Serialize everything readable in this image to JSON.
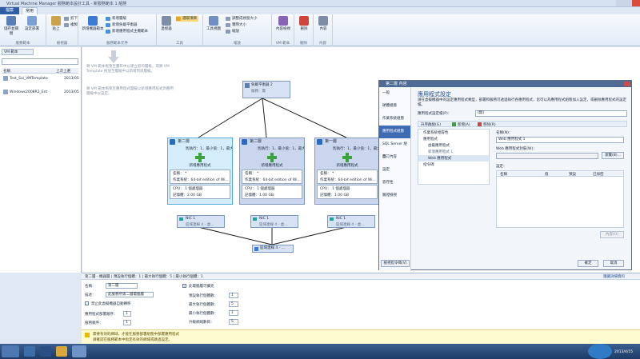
{
  "window": {
    "title": "Virtual Machine Manager 服務範本設計工具 - 新服務範本 1 組態"
  },
  "tabs": {
    "file": "檔案",
    "home": "常用"
  },
  "ribbon": {
    "save_run": "儲存並關閉",
    "set_config": "設定部署",
    "group_service_template": "服務範本",
    "cut": "剪下",
    "copy": "複製",
    "paste": "貼上",
    "group_edit": "檢視器",
    "new_vm_template": "新增機器範本",
    "new_tier": "新增層級",
    "new_app_tier": "新增服務層範本",
    "new_load_balancer": "新增負載平衡器",
    "new_logical_network": "新增應用程式主機範本",
    "group_components": "服務範本元件",
    "connect": "連接器",
    "select_item": "選取項目",
    "group_tools": "工具",
    "view_tools": "工具視圖",
    "zoom_normal": "調整成視窗大小",
    "zoom_actual": "實際大小",
    "zoom_level": "縮放",
    "group_view": "縮放",
    "vm_props": "內容檢視",
    "group_vm": "VM 範本",
    "delete": "刪除",
    "group_delete": "刪除",
    "properties": "內容",
    "group_props": "內容"
  },
  "leftpanel": {
    "tab": "VM 範本",
    "search_placeholder": "",
    "col_name": "名稱",
    "col_date": "上次上選",
    "items": [
      {
        "name": "Test_Sai_VMTemplate",
        "date": "2013/05"
      },
      {
        "name": "Windows2008R2_Ent",
        "date": "2013/05"
      }
    ]
  },
  "canvas": {
    "hint1": "將 VM 範本拖曳至畫布中以建立新的層級，或將 VM Template 拖放至層級中以新增到該層級。",
    "hint2": "將 VM 範本拖曳至應用程式層級以新增應用程式到應用層級中以設定。",
    "load_balancer": {
      "title": "負載平衡器 2",
      "sub": "服務：無"
    },
    "tiers": [
      {
        "title": "第二層",
        "counts": "別執行：1，最小值：1，最大值",
        "new_app": "新增應用程式",
        "name_label": "名稱：",
        "name_val": "*",
        "os": "作業系統：64-bit edition of Wi...",
        "cpu_label": "CPU：",
        "cpu_val": "1 個處理器",
        "mem": "記憶體：2.00 GB",
        "nic": "NIC 1",
        "nic_sub": "區域連線 4 - 虛..."
      },
      {
        "title": "第二層",
        "counts": "別執行：1，最小值：1，最大值",
        "new_app": "新增應用程式",
        "name_label": "名稱：",
        "name_val": "*",
        "os": "作業系統：64-bit edition of Wi...",
        "cpu_label": "CPU：",
        "cpu_val": "1 個處理器",
        "mem": "記憶體：1.00 GB",
        "nic": "NIC 1",
        "nic_sub": "區域連線 4 - 虛..."
      },
      {
        "title": "第一層",
        "counts": "別執行：1，最小值：1，最大值",
        "new_app": "新增應用程式",
        "name_label": "名稱：",
        "name_val": "*",
        "os": "作業系統：64-bit edition of Wi...",
        "cpu_label": "CPU：",
        "cpu_val": "1 個處理器",
        "mem": "記憶體：1.00 GB",
        "nic": "NIC 1",
        "nic_sub": "區域連線 4 - 虛..."
      }
    ],
    "network": "區域連線 4 - ..."
  },
  "dialog": {
    "title": "第二層 內容",
    "nav": [
      "一般",
      "硬體組態",
      "作業系統組態",
      "應用程式組態",
      "SQL Server 組態",
      "自訂內容",
      "設定",
      "容存性",
      "驗證檢視"
    ],
    "heading": "應用程式設定",
    "desc": "請在虛擬機器中的設定應用程式類型，部署和服務可透過執行各應用程式，您可以為應用程式組態加入設定，或刪除應用程式的設定檔。",
    "profile_label": "應用程式設定檔(P)：",
    "profile_value": "[無]",
    "toolbar_new": "升序群組(G)",
    "toolbar_add": "新增(A)",
    "toolbar_remove": "移除(R)",
    "tree": [
      "作業系統相容性",
      "應用程式",
      "虛擬應用程式",
      "新增應用程式 1",
      "Web 應用程式",
      "指令碼"
    ],
    "name_label": "名稱(N)：",
    "name_value": "Web 應用程式 1",
    "web_label": "Web 應用程式封裝(W)：",
    "browse": "瀏覽(B)...",
    "settings_label": "設定：",
    "grid_cols": [
      "名稱",
      "值",
      "預設",
      "已加密"
    ],
    "btn_props": "內容(O)",
    "btn_script": "檢視指令碼(V)",
    "ok": "確定",
    "cancel": "取消"
  },
  "bottom": {
    "status": "第二層 - 機器層 | 預設執行個體：1 | 最大執行個體：5 | 最小執行個體：1",
    "more": "隱藏詳細資料",
    "name_label": "名稱：",
    "name_val": "第二層",
    "desc_label": "描述：",
    "desc_val": "此服務所第二層電腦層",
    "checkbox_scale": "此電腦層可擴充",
    "checkbox_prevent": "禁止此虛擬機器自動轉移",
    "def_instances_label": "預設執行個體數：",
    "def_instances": "1",
    "max_instances_label": "最大執行個體數：",
    "max_instances": "5",
    "min_instances_label": "最小執行個體數：",
    "min_instances": "1",
    "upgrade_domain_label": "升級網域數目：",
    "upgrade_domain": "5",
    "app_deploy_label": "應用程式部署順序：",
    "app_deploy": "1",
    "service_label": "服務順序：",
    "service_val": "1"
  },
  "warning": {
    "line1": "需要有效的網域，才能在服務部署組態中部署應用程式",
    "line2": "請確認在服務範本中指定有效的網域或跳過設定。"
  },
  "taskbar": {
    "clock": "2013/4/15"
  },
  "colors": {
    "accent": "#2f5ea7",
    "tier_bg": "#d7e3f4",
    "warning_bg": "#fffbd0"
  }
}
